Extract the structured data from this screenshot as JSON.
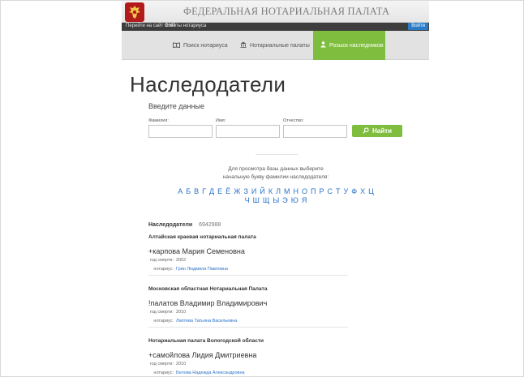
{
  "header": {
    "brand": "ФЕДЕРАЛЬНАЯ НОТАРИАЛЬНАЯ ПАЛАТА",
    "brand_color": "#b31b1b"
  },
  "topbar": {
    "link_site": "Перейти на сайт ФНП",
    "link_advice": "Советы нотариуса",
    "login": "Войти"
  },
  "nav": {
    "search_notary": "Поиск нотариуса",
    "chambers": "Нотариальные палаты",
    "heirs_search": "Розыск наследников",
    "accent": "#7fbd3f"
  },
  "page_title": "Наследодатели",
  "form": {
    "heading": "Введите данные",
    "surname_label": "Фамилия:",
    "name_label": "Имя:",
    "patronymic_label": "Отчество:",
    "find_label": "Найти"
  },
  "hint": "Для просмотра базы данных выберите начальную букву фамилии наследодателя:",
  "alphabet_row1": [
    "А",
    "Б",
    "В",
    "Г",
    "Д",
    "Е",
    "Ё",
    "Ж",
    "З",
    "И",
    "Й",
    "К",
    "Л",
    "М",
    "Н",
    "О",
    "П",
    "Р",
    "С",
    "Т",
    "У",
    "Ф",
    "Х",
    "Ц"
  ],
  "alphabet_row2": [
    "Ч",
    "Ш",
    "Щ",
    "Ы",
    "Э",
    "Ю",
    "Я"
  ],
  "results": {
    "label": "Наследодатели",
    "count": "6942988",
    "death_year_label": "год смерти:",
    "notary_label": "нотариус:",
    "items": [
      {
        "chamber": "Алтайская краевая нотариальная палата",
        "person": "+карпова Мария Семеновна",
        "year": "2002",
        "notary": "Грин Людмила Павловна"
      },
      {
        "chamber": "Московская областная Нотариальная Палата",
        "person": "!палатов Владимир Владимирович",
        "year": "2010",
        "notary": "Лаптева Татьяна Васильевна"
      },
      {
        "chamber": "Нотариальная палата Вологодской области",
        "person": "+самойлова Лидия Дмитриевна",
        "year": "2010",
        "notary": "Белова Надежда Александровна"
      }
    ]
  }
}
